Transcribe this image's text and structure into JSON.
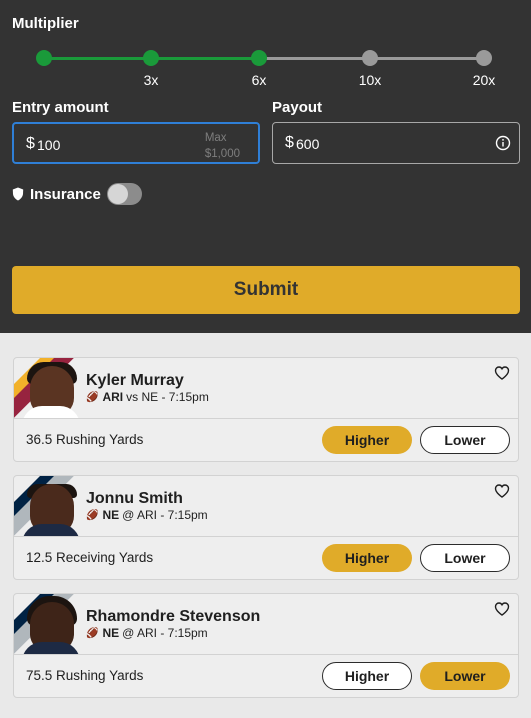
{
  "multiplier": {
    "title": "Multiplier",
    "ticks": [
      "3x",
      "6x",
      "10x",
      "20x"
    ],
    "active_color": "#1a9a3a",
    "inactive_color": "#9a9a9a"
  },
  "entry": {
    "label": "Entry amount",
    "currency": "$",
    "value": "100",
    "max_label": "Max",
    "max_value": "$1,000"
  },
  "payout": {
    "label": "Payout",
    "currency": "$",
    "value": "600",
    "info_icon": "info-icon"
  },
  "insurance": {
    "label": "Insurance",
    "icon": "shield-icon",
    "enabled": false
  },
  "submit_label": "Submit",
  "colors": {
    "accent": "#e0ab29",
    "panel": "#333333"
  },
  "picks": [
    {
      "name": "Kyler Murray",
      "team": "ARI",
      "matchup": "vs NE - 7:15pm",
      "stat": "36.5 Rushing Yards",
      "higher": "Higher",
      "lower": "Lower",
      "selected": "higher",
      "team_colors": [
        "#f2b12a",
        "#97233f"
      ]
    },
    {
      "name": "Jonnu Smith",
      "team": "NE",
      "matchup": "@ ARI - 7:15pm",
      "stat": "12.5 Receiving Yards",
      "higher": "Higher",
      "lower": "Lower",
      "selected": "higher",
      "team_colors": [
        "#002244",
        "#b0b7bc"
      ]
    },
    {
      "name": "Rhamondre Stevenson",
      "team": "NE",
      "matchup": "@ ARI - 7:15pm",
      "stat": "75.5 Rushing Yards",
      "higher": "Higher",
      "lower": "Lower",
      "selected": "lower",
      "team_colors": [
        "#002244",
        "#b0b7bc"
      ]
    }
  ]
}
